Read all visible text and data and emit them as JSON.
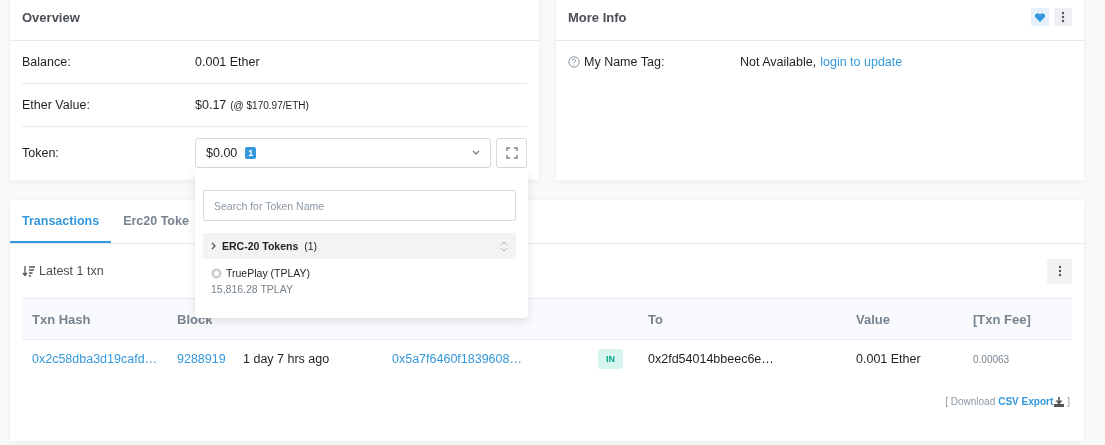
{
  "overview": {
    "title": "Overview",
    "rows": [
      {
        "label": "Balance:",
        "value": "0.001 Ether"
      },
      {
        "label": "Ether Value:",
        "value": "$0.17",
        "note": "(@ $170.97/ETH)"
      }
    ],
    "token": {
      "label": "Token:",
      "value": "$0.00",
      "count": "1"
    }
  },
  "token_dropdown": {
    "search": {
      "placeholder": "Search for Token Name"
    },
    "group": {
      "label": "ERC-20 Tokens",
      "count": "(1)"
    },
    "items": [
      {
        "name": "TruePlay (TPLAY)",
        "amount": "15,816.28 TPLAY"
      }
    ]
  },
  "more_info": {
    "title": "More Info",
    "name_tag": {
      "label": "My Name Tag:",
      "value": "Not Available,",
      "link": "login to update"
    }
  },
  "transactions": {
    "tabs": [
      {
        "label": "Transactions",
        "selected": true
      },
      {
        "label": "Erc20 Toke",
        "selected": false
      }
    ],
    "summary": "Latest 1 txn",
    "table": {
      "columns": [
        {
          "label": "Txn Hash",
          "kind": "plain"
        },
        {
          "label": "Block",
          "kind": "plain"
        },
        {
          "kind": "blank"
        },
        {
          "kind": "blank"
        },
        {
          "kind": "blank"
        },
        {
          "label": "To",
          "kind": "plain"
        },
        {
          "label": "Value",
          "kind": "plain"
        },
        {
          "label": "[Txn Fee]",
          "kind": "plain"
        }
      ],
      "rows": [
        {
          "cells": [
            {
              "kind": "link",
              "text": "0x2c58dba3d19cafd…"
            },
            {
              "kind": "link",
              "text": "9288919"
            },
            {
              "kind": "text",
              "text": "1 day 7 hrs ago"
            },
            {
              "kind": "link",
              "text": "0x5a7f6460f1839608…"
            },
            {
              "kind": "badge",
              "text": "IN"
            },
            {
              "kind": "text",
              "text": "0x2fd54014bbeec6e…"
            },
            {
              "kind": "text",
              "text": "0.001 Ether"
            },
            {
              "kind": "small",
              "text": "0.00063"
            }
          ]
        }
      ]
    },
    "download": {
      "prefix": "[ Download",
      "link": "CSV Export",
      "suffix": "]"
    }
  }
}
